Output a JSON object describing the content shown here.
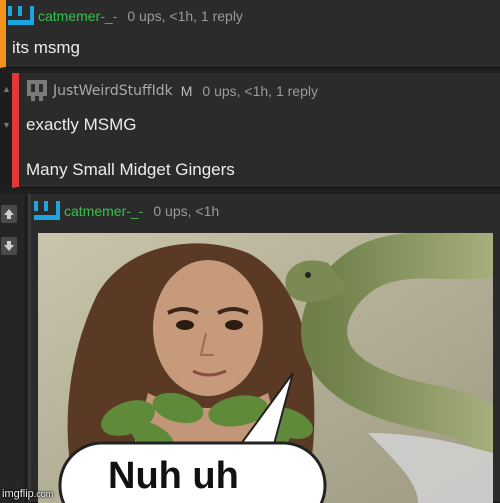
{
  "comments": [
    {
      "username": "catmemer-_-",
      "meta": "0 ups, <1h, 1 reply",
      "body": "its msmg",
      "accent": "#f2931e"
    },
    {
      "username": "JustWeirdStuffIdk",
      "mod_badge": "M",
      "meta": "0 ups, <1h, 1 reply",
      "body_lines": [
        "exactly MSMG",
        "Many Small Midget Gingers"
      ],
      "accent": "#e23838"
    },
    {
      "username": "catmemer-_-",
      "meta": "0 ups, <1h",
      "image": {
        "icon": "meme-image",
        "caption": "Nuh uh"
      }
    }
  ],
  "icons": {
    "upvote": "arrow-up-icon",
    "downvote": "arrow-down-icon",
    "avatar_user": "pixel-avatar-icon"
  },
  "watermark": {
    "main": "imgflip",
    "suffix": ".com"
  },
  "colors": {
    "username_green": "#38c24e",
    "background": "#1f1f1f",
    "comment_bg": "#2b2b2b"
  }
}
